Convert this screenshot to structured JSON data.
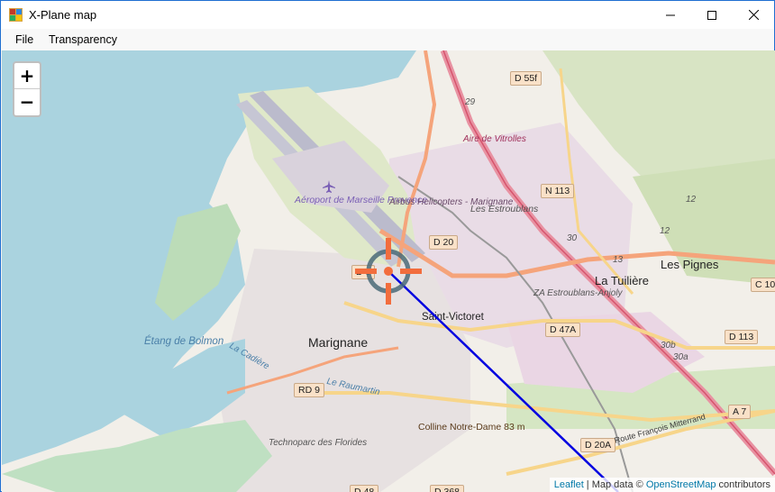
{
  "window": {
    "title": "X-Plane map",
    "icon": "app-map-icon",
    "controls": {
      "minimize": "minimize-icon",
      "maximize": "maximize-icon",
      "close": "close-icon"
    }
  },
  "menu": {
    "file": "File",
    "transparency": "Transparency"
  },
  "zoom": {
    "in": "+",
    "out": "−"
  },
  "map": {
    "roads": {
      "d55f": "D 55f",
      "n113": "N 113",
      "d20": "D 20",
      "d47a": "D 47A",
      "d113": "D 113",
      "c10": "C 10",
      "rd9": "RD 9",
      "a7": "A 7",
      "d20a": "D 20A",
      "d48": "D 48",
      "d368": "D 368",
      "d9": "D 9"
    },
    "places": {
      "airport": "Aéroport de Marseille Provence",
      "airbus": "Airbus Helicopters - Marignane",
      "aire": "Aire de Vitrolles",
      "estroublans": "Les Estroublans",
      "pignes": "Les Pignes",
      "tuiliere": "La Tuilière",
      "za": "ZA Estroublans-Anjoly",
      "stvictoret": "Saint-Victoret",
      "marignane": "Marignane",
      "etang": "Étang de Bolmon",
      "cadiere": "La Cadière",
      "raumartin": "Le Raumartin",
      "colline": "Colline Notre-Dame 83 m",
      "technoparc": "Technoparc des Florides",
      "route": "Route François Mitterrand",
      "vitrolles_num": "29",
      "n30": "30",
      "n13": "13",
      "n12": "12",
      "n12b": "12",
      "n30b": "30b",
      "n30a": "30a"
    },
    "marker": {
      "icon": "crosshair-icon",
      "color": "#f26d3d"
    },
    "track": {
      "color": "#0000e0"
    }
  },
  "attribution": {
    "leaflet": "Leaflet",
    "sep": " | Map data © ",
    "osm": "OpenStreetMap",
    "tail": " contributors"
  }
}
